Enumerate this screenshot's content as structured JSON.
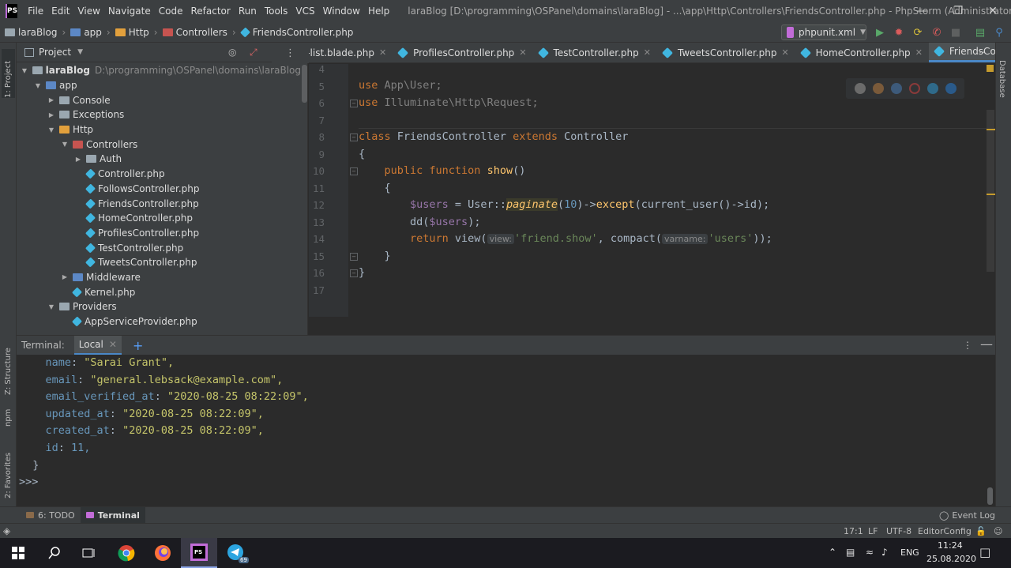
{
  "window": {
    "logo": "PS",
    "menu": [
      "File",
      "Edit",
      "View",
      "Navigate",
      "Code",
      "Refactor",
      "Run",
      "Tools",
      "VCS",
      "Window",
      "Help"
    ],
    "title": "laraBlog [D:\\programming\\OSPanel\\domains\\laraBlog] - ...\\app\\Http\\Controllers\\FriendsController.php - PhpStorm (Administrator)"
  },
  "navbar": {
    "breadcrumbs": [
      "laraBlog",
      "app",
      "Http",
      "Controllers",
      "FriendsController.php"
    ],
    "run_config": "phpunit.xml"
  },
  "left_strip": {
    "project": "1: Project",
    "structure": "Z: Structure",
    "npm": "npm",
    "favorites": "2: Favorites"
  },
  "right_strip": {
    "database": "Database"
  },
  "project_panel": {
    "title": "Project",
    "tree": [
      {
        "label": "laraBlog",
        "hint": "D:\\programming\\OSPanel\\domains\\laraBlog",
        "depth": 0,
        "expanded": true,
        "icon": "folder-gray",
        "bold": true
      },
      {
        "label": "app",
        "depth": 1,
        "expanded": true,
        "icon": "folder-blue"
      },
      {
        "label": "Console",
        "depth": 2,
        "expanded": false,
        "icon": "folder-gray"
      },
      {
        "label": "Exceptions",
        "depth": 2,
        "expanded": false,
        "icon": "folder-gray"
      },
      {
        "label": "Http",
        "depth": 2,
        "expanded": true,
        "icon": "folder-orange"
      },
      {
        "label": "Controllers",
        "depth": 3,
        "expanded": true,
        "icon": "folder-red"
      },
      {
        "label": "Auth",
        "depth": 4,
        "expanded": false,
        "icon": "folder-gray"
      },
      {
        "label": "Controller.php",
        "depth": 4,
        "icon": "php"
      },
      {
        "label": "FollowsController.php",
        "depth": 4,
        "icon": "php"
      },
      {
        "label": "FriendsController.php",
        "depth": 4,
        "icon": "php"
      },
      {
        "label": "HomeController.php",
        "depth": 4,
        "icon": "php"
      },
      {
        "label": "ProfilesController.php",
        "depth": 4,
        "icon": "php"
      },
      {
        "label": "TestController.php",
        "depth": 4,
        "icon": "php"
      },
      {
        "label": "TweetsController.php",
        "depth": 4,
        "icon": "php"
      },
      {
        "label": "Middleware",
        "depth": 3,
        "expanded": false,
        "icon": "folder-blue"
      },
      {
        "label": "Kernel.php",
        "depth": 3,
        "icon": "php"
      },
      {
        "label": "Providers",
        "depth": 2,
        "expanded": true,
        "icon": "folder-gray"
      },
      {
        "label": "AppServiceProvider.php",
        "depth": 3,
        "icon": "php"
      }
    ]
  },
  "editor_tabs": [
    {
      "label": "ids-list.blade.php",
      "active": false
    },
    {
      "label": "ProfilesController.php",
      "active": false
    },
    {
      "label": "TestController.php",
      "active": false
    },
    {
      "label": "TweetsController.php",
      "active": false
    },
    {
      "label": "HomeController.php",
      "active": false
    },
    {
      "label": "FriendsController.php",
      "active": true
    }
  ],
  "editor": {
    "line_numbers": [
      "4",
      "5",
      "6",
      "7",
      "8",
      "9",
      "10",
      "11",
      "12",
      "13",
      "14",
      "15",
      "16",
      "17"
    ],
    "code": {
      "l5_kw": "use",
      "l5_rest": " App\\User;",
      "l6_kw": "use",
      "l6_rest": " Illuminate\\Http\\Request;",
      "l8_kw1": "class",
      "l8_cls": " FriendsController ",
      "l8_kw2": "extends",
      "l8_parent": " Controller",
      "l9": "{",
      "l10_kw": "    public function ",
      "l10_fn": "show",
      "l10_rest": "()",
      "l11": "    {",
      "l12_var": "        $users",
      "l12_a": " = User::",
      "l12_it": "paginate",
      "l12_b": "(",
      "l12_num": "10",
      "l12_c": ")->",
      "l12_fn": "except",
      "l12_d": "(current_user()->id);",
      "l13_a": "        dd(",
      "l13_var": "$users",
      "l13_b": ");",
      "l14_kw": "        return ",
      "l14_a": "view(",
      "l14_hint1": "view:",
      "l14_str1": "'friend.show'",
      "l14_b": ", compact(",
      "l14_hint2": "varname:",
      "l14_str2": "'users'",
      "l14_c": "));",
      "l15": "    }",
      "l16": "}"
    }
  },
  "terminal": {
    "label": "Terminal:",
    "tab": "Local",
    "lines": [
      {
        "key": "name",
        "value": "\"Sarai Grant\","
      },
      {
        "key": "email",
        "value": "\"general.lebsack@example.com\","
      },
      {
        "key": "email_verified_at",
        "value": "\"2020-08-25 08:22:09\","
      },
      {
        "key": "updated_at",
        "value": "\"2020-08-25 08:22:09\","
      },
      {
        "key": "created_at",
        "value": "\"2020-08-25 08:22:09\","
      },
      {
        "key": "id",
        "value": "11,"
      }
    ],
    "close_brace": "}",
    "prompt": ">>>"
  },
  "bottom_tabs": {
    "todo": "6: TODO",
    "terminal": "Terminal",
    "event_log": "Event Log"
  },
  "statusbar": {
    "position": "17:1",
    "line_sep": "LF",
    "encoding": "UTF-8",
    "editorconfig": "EditorConfig"
  },
  "taskbar": {
    "lang": "ENG",
    "time": "11:24",
    "date": "25.08.2020",
    "telegram_badge": "69"
  },
  "colors": {
    "accent": "#4a88c7",
    "bg": "#2b2b2b",
    "panel": "#3c3f41"
  }
}
